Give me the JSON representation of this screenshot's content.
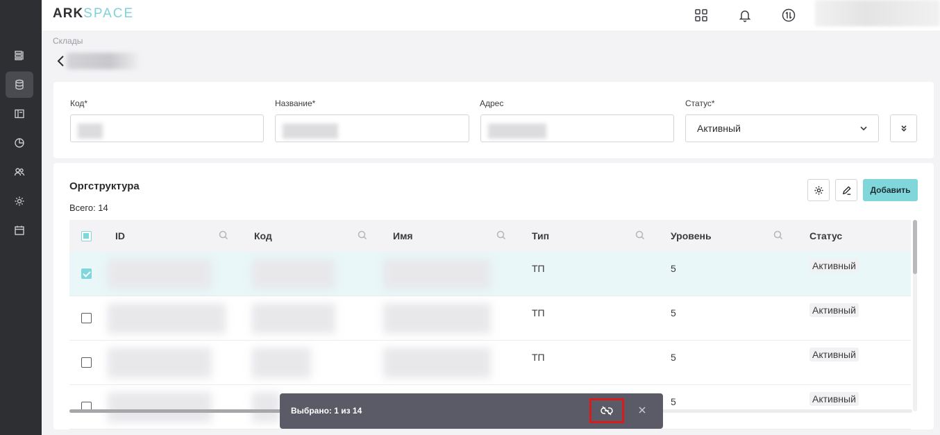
{
  "header": {
    "logo_ark": "ARK",
    "logo_space": "SPACE"
  },
  "breadcrumb": "Склады",
  "form": {
    "code_label": "Код*",
    "name_label": "Название*",
    "address_label": "Адрес",
    "status_label": "Статус*",
    "status_value": "Активный"
  },
  "org": {
    "title": "Оргструктура",
    "total": "Всего: 14",
    "add_label": "Добавить",
    "columns": [
      "ID",
      "Код",
      "Имя",
      "Тип",
      "Уровень",
      "Статус"
    ],
    "rows": [
      {
        "type": "ТП",
        "level": "5",
        "status": "Активный",
        "selected": true
      },
      {
        "type": "ТП",
        "level": "5",
        "status": "Активный",
        "selected": false
      },
      {
        "type": "ТП",
        "level": "5",
        "status": "Активный",
        "selected": false
      },
      {
        "type": "",
        "level": "5",
        "status": "Активный",
        "selected": false
      }
    ]
  },
  "selection": {
    "text": "Выбрано: 1 из 14"
  },
  "colors": {
    "accent": "#7fd6db",
    "sidebar": "#2e2f33",
    "toast": "#5a5b66",
    "highlight": "#d81c1c"
  }
}
